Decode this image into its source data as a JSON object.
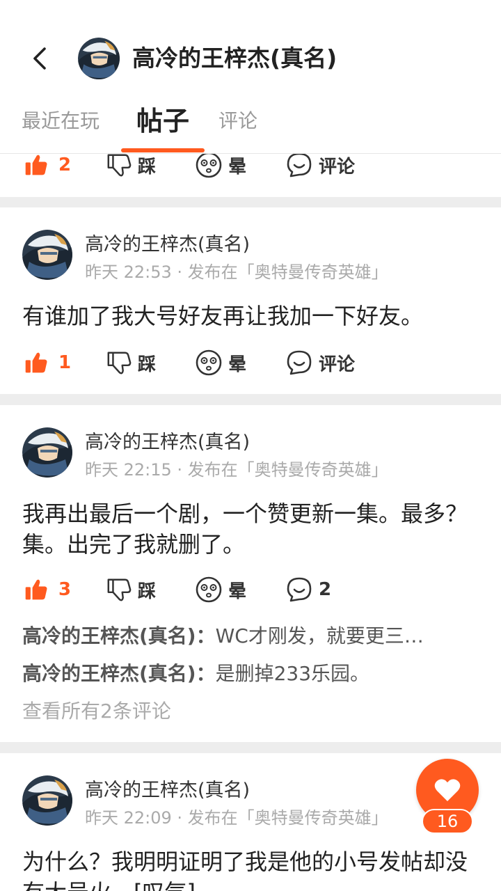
{
  "header": {
    "title": "高冷的王梓杰(真名)"
  },
  "tabs": [
    {
      "label": "最近在玩"
    },
    {
      "label": "帖子"
    },
    {
      "label": "评论"
    }
  ],
  "colors": {
    "accent": "#ff5a1f"
  },
  "actions_labels": {
    "dislike": "踩",
    "dizzy": "晕",
    "comment": "评论"
  },
  "posts": [
    {
      "like_count": "2",
      "comment_label": "评论"
    },
    {
      "author": "高冷的王梓杰(真名)",
      "meta": "昨天 22:53 · 发布在「奥特曼传奇英雄」",
      "content": "有谁加了我大号好友再让我加一下好友。",
      "like_count": "1",
      "comment_label": "评论"
    },
    {
      "author": "高冷的王梓杰(真名)",
      "meta": "昨天 22:15 · 发布在「奥特曼传奇英雄」",
      "content": "我再出最后一个剧，一个赞更新一集。最多？集。出完了我就删了。",
      "like_count": "3",
      "comment_label": "2",
      "comments": [
        {
          "who": "高冷的王梓杰(真名)：",
          "text": "WC才刚发，就要更三…"
        },
        {
          "who": "高冷的王梓杰(真名)：",
          "text": "是删掉233乐园。"
        }
      ],
      "view_all": "查看所有2条评论"
    },
    {
      "author": "高冷的王梓杰(真名)",
      "meta": "昨天 22:09 · 发布在「奥特曼传奇英雄」",
      "content": "为什么？我明明证明了我是他的小号发帖却没有大号火。[叹气]"
    }
  ],
  "fab": {
    "count": "16"
  }
}
